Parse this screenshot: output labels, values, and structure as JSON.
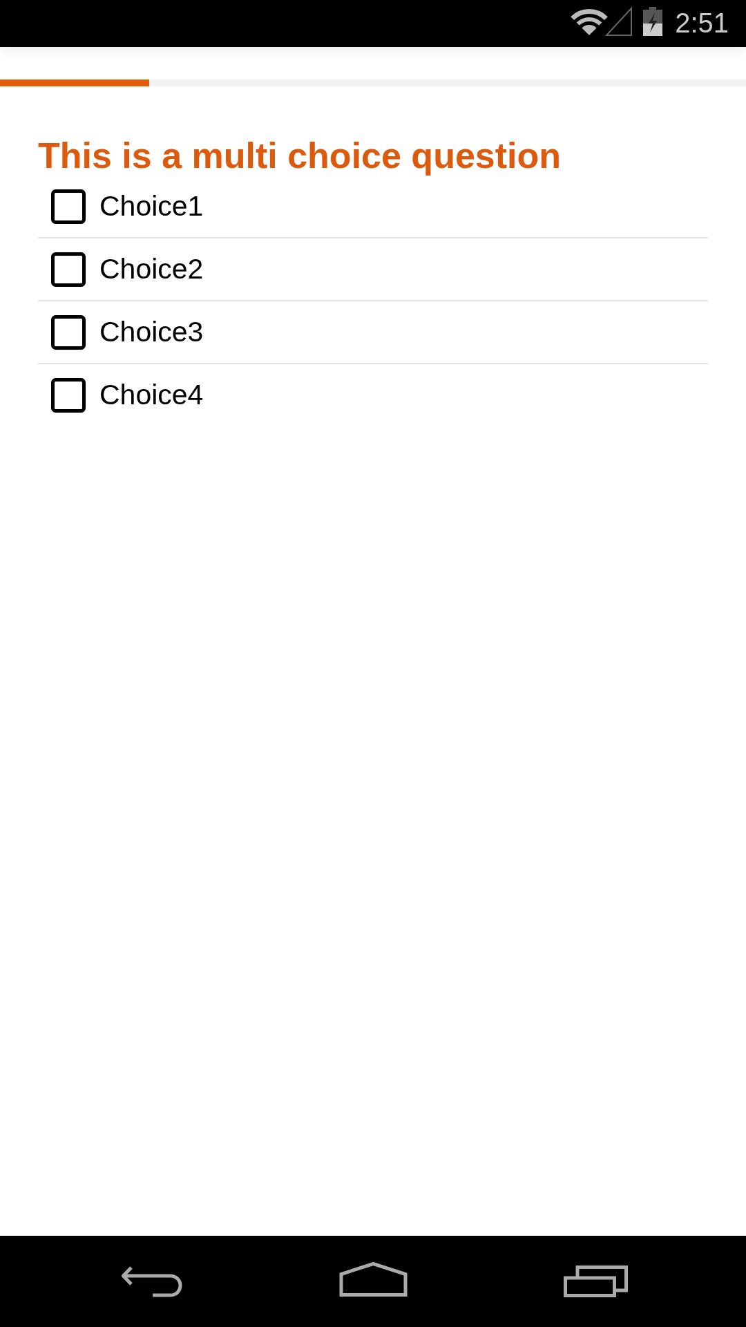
{
  "status_bar": {
    "time": "2:51"
  },
  "progress": {
    "level": 0.2
  },
  "question": {
    "title": "This is a multi choice question",
    "choices": [
      {
        "label": "Choice1",
        "checked": false
      },
      {
        "label": "Choice2",
        "checked": false
      },
      {
        "label": "Choice3",
        "checked": false
      },
      {
        "label": "Choice4",
        "checked": false
      }
    ]
  }
}
